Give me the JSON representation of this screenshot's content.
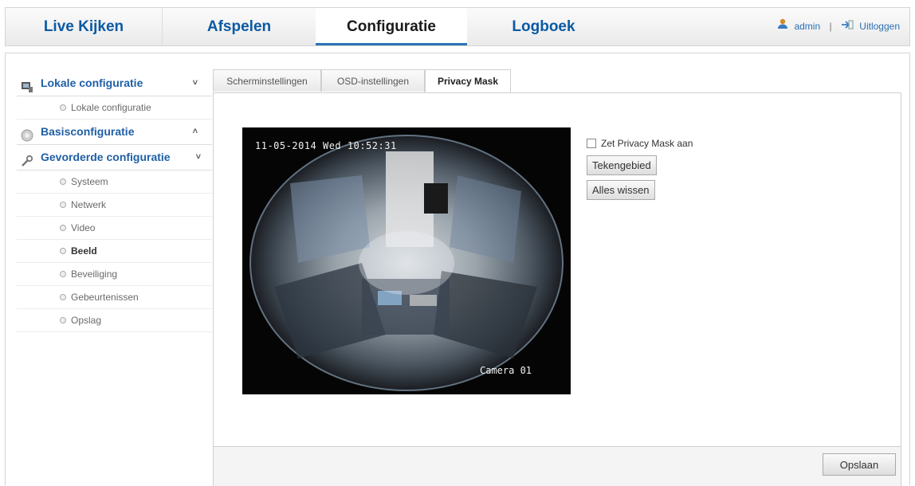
{
  "nav": {
    "tabs": [
      {
        "label": "Live Kijken"
      },
      {
        "label": "Afspelen"
      },
      {
        "label": "Configuratie"
      },
      {
        "label": "Logboek"
      }
    ],
    "active_tab": "Configuratie",
    "user": "admin",
    "logout": "Uitloggen"
  },
  "sidebar": {
    "sections": [
      {
        "label": "Lokale configuratie",
        "icon": "monitor-icon",
        "chevron": "˅",
        "items": [
          {
            "label": "Lokale configuratie"
          }
        ]
      },
      {
        "label": "Basisconfiguratie",
        "icon": "circle-icon",
        "chevron": "˄"
      },
      {
        "label": "Gevorderde configuratie",
        "icon": "wrench-icon",
        "chevron": "˅",
        "items": [
          {
            "label": "Systeem"
          },
          {
            "label": "Netwerk"
          },
          {
            "label": "Video"
          },
          {
            "label": "Beeld"
          },
          {
            "label": "Beveiliging"
          },
          {
            "label": "Gebeurtenissen"
          },
          {
            "label": "Opslag"
          }
        ]
      }
    ],
    "active_item": "Beeld"
  },
  "content": {
    "tabs": [
      {
        "label": "Scherminstellingen"
      },
      {
        "label": "OSD-instellingen"
      },
      {
        "label": "Privacy Mask"
      }
    ],
    "active_tab": "Privacy Mask",
    "video": {
      "osd_time": "11-05-2014 Wed 10:52:31",
      "osd_camera": "Camera 01"
    },
    "privacy_mask_checkbox": "Zet Privacy Mask aan",
    "draw_button": "Tekengebied",
    "clear_button": "Alles wissen",
    "save_button": "Opslaan"
  },
  "colors": {
    "accent": "#2a73b8",
    "link": "#1f5fa6"
  }
}
